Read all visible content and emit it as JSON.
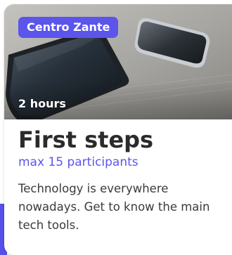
{
  "course": {
    "provider": "Centro Zante",
    "duration": "2 hours",
    "title": "First steps",
    "capacity": "max 15 participants",
    "description": "Technology is everywhere nowadays. Get to know the main tech tools."
  },
  "colors": {
    "accent": "#5b55ec",
    "title": "#2b2b2b",
    "body_text": "#3b3b3b"
  }
}
